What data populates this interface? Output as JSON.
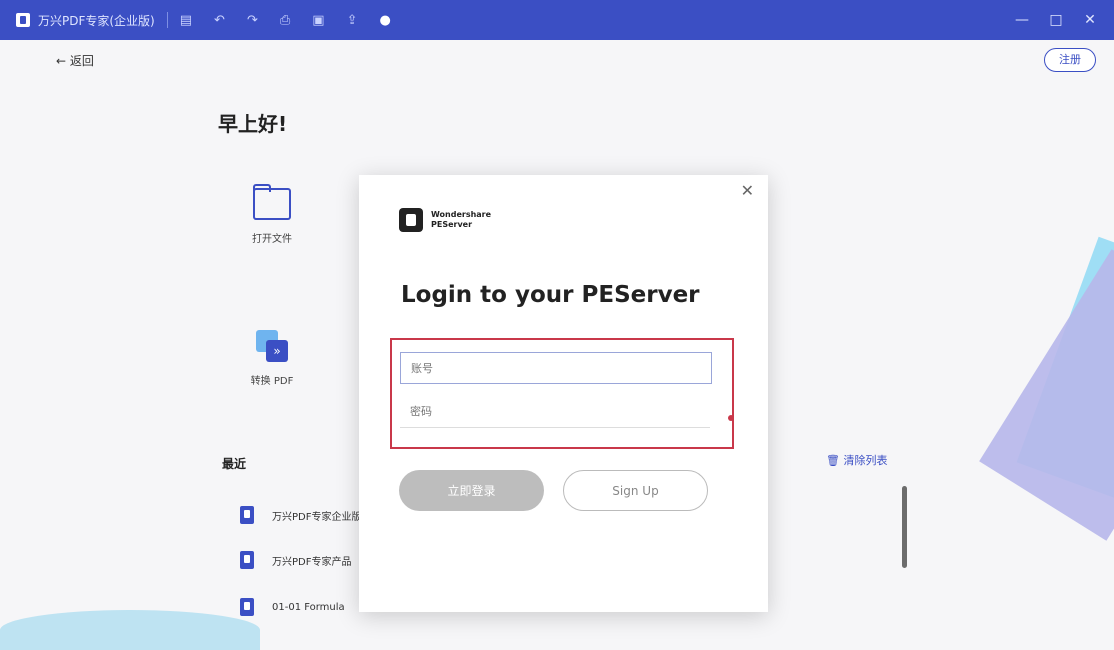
{
  "window": {
    "title": "万兴PDF专家(企业版)",
    "toolbar_icons": [
      "file-icon",
      "undo-icon",
      "redo-icon",
      "print-icon",
      "save-icon",
      "share-icon",
      "help-icon"
    ],
    "accent": "#3b4fc4"
  },
  "home": {
    "back_label": "← 返回",
    "signin_label": "注册",
    "greeting": "早上好!",
    "tools": [
      {
        "label": "打开文件",
        "icon": "folder-icon"
      },
      {
        "label": "转换 PDF",
        "icon": "convert-icon"
      }
    ],
    "recent": {
      "title": "最近",
      "clear_label": "清除列表",
      "items": [
        {
          "name": "万兴PDF专家企业版"
        },
        {
          "name": "万兴PDF专家产品"
        },
        {
          "name": "01-01 Formula"
        }
      ]
    }
  },
  "dialog": {
    "brand_line1": "Wondershare",
    "brand_line2": "PEServer",
    "heading": "Login to your PEServer",
    "username_placeholder": "账号",
    "password_placeholder": "密码",
    "login_label": "立即登录",
    "signup_label": "Sign Up"
  }
}
